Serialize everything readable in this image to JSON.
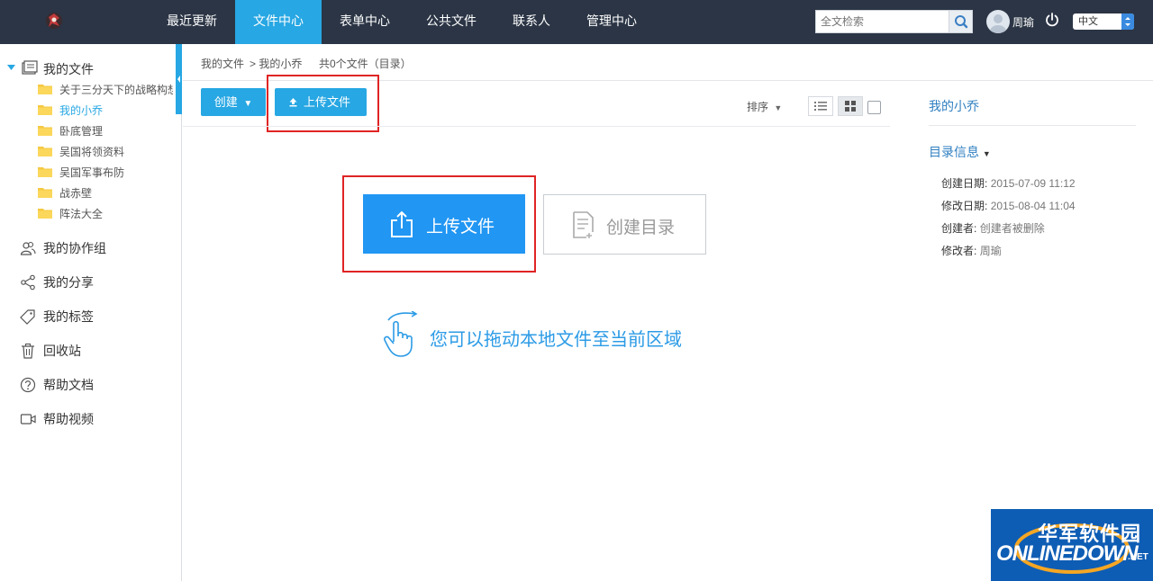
{
  "nav": {
    "items": [
      {
        "label": "最近更新",
        "active": false
      },
      {
        "label": "文件中心",
        "active": true
      },
      {
        "label": "表单中心",
        "active": false
      },
      {
        "label": "公共文件",
        "active": false
      },
      {
        "label": "联系人",
        "active": false
      },
      {
        "label": "管理中心",
        "active": false
      }
    ],
    "search_placeholder": "全文检索",
    "username": "周瑜",
    "language": "中文"
  },
  "sidebar": {
    "root_label": "我的文件",
    "folders": [
      {
        "label": "关于三分天下的战略构想",
        "active": false
      },
      {
        "label": "我的小乔",
        "active": true
      },
      {
        "label": "卧底管理",
        "active": false
      },
      {
        "label": "吴国将领资料",
        "active": false
      },
      {
        "label": "吴国军事布防",
        "active": false
      },
      {
        "label": "战赤壁",
        "active": false
      },
      {
        "label": "阵法大全",
        "active": false
      }
    ],
    "items": [
      {
        "label": "我的协作组",
        "icon": "group-icon"
      },
      {
        "label": "我的分享",
        "icon": "share-icon"
      },
      {
        "label": "我的标签",
        "icon": "tag-icon"
      },
      {
        "label": "回收站",
        "icon": "trash-icon"
      },
      {
        "label": "帮助文档",
        "icon": "help-icon"
      },
      {
        "label": "帮助视频",
        "icon": "video-icon"
      }
    ]
  },
  "breadcrumb": {
    "root": "我的文件",
    "current": "> 我的小乔",
    "count": "共0个文件（目录）"
  },
  "toolbar": {
    "create_label": "创建",
    "upload_label": "上传文件",
    "sort_label": "排序"
  },
  "empty_state": {
    "upload_label": "上传文件",
    "mkdir_label": "创建目录",
    "drag_hint": "您可以拖动本地文件至当前区域"
  },
  "right_panel": {
    "title": "我的小乔",
    "section": "目录信息",
    "rows": [
      {
        "key": "创建日期:",
        "value": "2015-07-09 11:12"
      },
      {
        "key": "修改日期:",
        "value": "2015-08-04 11:04"
      },
      {
        "key": "创建者:",
        "value": "创建者被删除"
      },
      {
        "key": "修改者:",
        "value": "周瑜"
      }
    ]
  },
  "watermark": {
    "cn": "华军软件园",
    "en": "ONLINEDOWN",
    "net": ".NET"
  },
  "colors": {
    "topbar": "#2b3545",
    "accent": "#27a7e3",
    "upload_big": "#2196f3",
    "highlight_box": "#e02424"
  }
}
